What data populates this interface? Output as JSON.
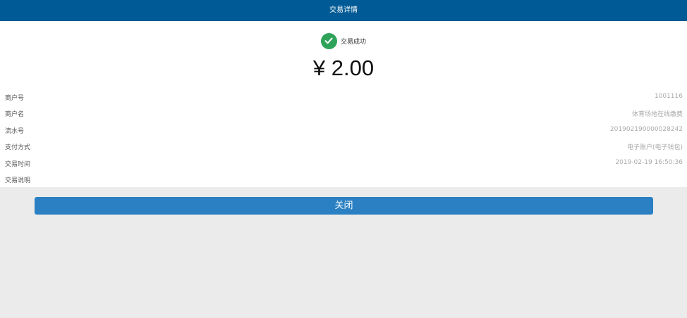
{
  "header": {
    "title": "交易详情"
  },
  "status": {
    "text": "交易成功",
    "icon": "check-circle-icon",
    "color": "#2fa35a"
  },
  "amount": "¥ 2.00",
  "details": [
    {
      "label": "商户号",
      "value": "1001116"
    },
    {
      "label": "商户名",
      "value": "体育场地在线缴费"
    },
    {
      "label": "流水号",
      "value": "201902190000028242"
    },
    {
      "label": "支付方式",
      "value": "电子账户(电子钱包)"
    },
    {
      "label": "交易时间",
      "value": "2019-02-19 16:50:36"
    },
    {
      "label": "交易说明",
      "value": ""
    }
  ],
  "close_button": {
    "label": "关闭"
  },
  "colors": {
    "header": "#005a95",
    "button": "#2a80c2",
    "background": "#ebebeb"
  }
}
